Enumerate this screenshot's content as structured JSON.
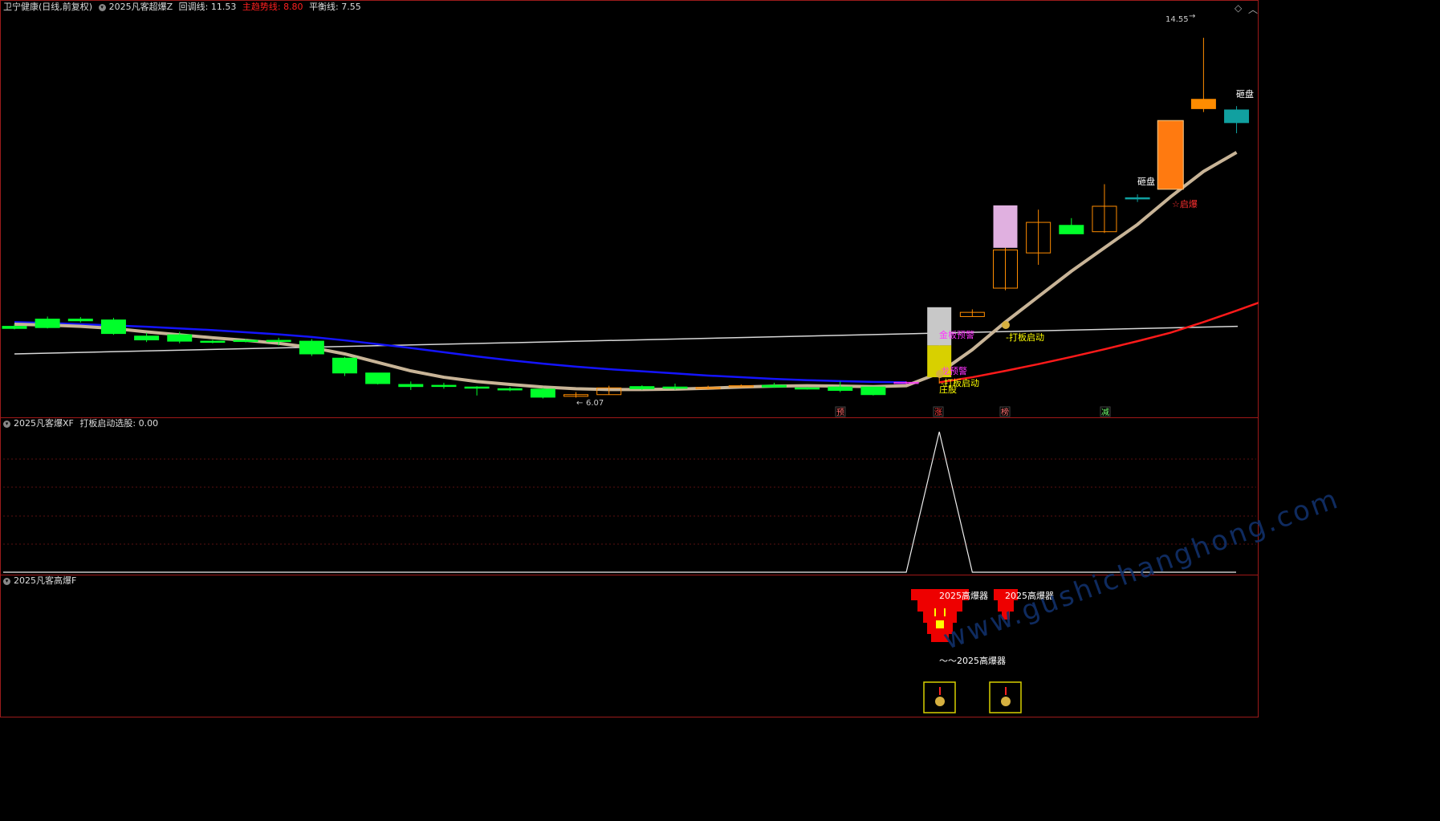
{
  "header": {
    "stock_name": "卫宁健康(日线,前复权)",
    "indicator_name": "2025凡客超爆Z",
    "retrace_label": "回调线:",
    "retrace_value": "11.53",
    "main_label": "主趋势线:",
    "main_value": "8.80",
    "balance_label": "平衡线:",
    "balance_value": "7.55",
    "icons": [
      "diamond-outline-icon",
      "caret-up-icon"
    ]
  },
  "pane2": {
    "title": "2025凡客爆XF",
    "label": "打板启动选股:",
    "value": "0.00"
  },
  "pane3": {
    "title": "2025凡客高爆F"
  },
  "watermark": "www.gushichanghong.com",
  "colors": {
    "up": "#ff8c00",
    "down": "#00ff2a",
    "avg": "#c8b497",
    "blue": "#1414ff",
    "red": "#ff1a1a",
    "white": "#d8d8d8",
    "magenta": "#ff33ff",
    "yellow": "#ffff00"
  },
  "chart_data": {
    "type": "candlestick",
    "price_range": [
      5.7,
      15.1
    ],
    "candles": [
      {
        "o": 7.75,
        "h": 7.8,
        "l": 7.68,
        "c": 7.7
      },
      {
        "o": 7.92,
        "h": 7.98,
        "l": 7.7,
        "c": 7.72
      },
      {
        "o": 7.92,
        "h": 7.97,
        "l": 7.84,
        "c": 7.88
      },
      {
        "o": 7.9,
        "h": 7.95,
        "l": 7.55,
        "c": 7.58
      },
      {
        "o": 7.52,
        "h": 7.6,
        "l": 7.38,
        "c": 7.43
      },
      {
        "o": 7.55,
        "h": 7.62,
        "l": 7.35,
        "c": 7.4
      },
      {
        "o": 7.4,
        "h": 7.43,
        "l": 7.35,
        "c": 7.38
      },
      {
        "o": 7.42,
        "h": 7.45,
        "l": 7.37,
        "c": 7.4
      },
      {
        "o": 7.42,
        "h": 7.48,
        "l": 7.3,
        "c": 7.4
      },
      {
        "o": 7.4,
        "h": 7.45,
        "l": 7.05,
        "c": 7.1
      },
      {
        "o": 7.0,
        "h": 7.03,
        "l": 6.58,
        "c": 6.65
      },
      {
        "o": 6.65,
        "h": 6.65,
        "l": 6.38,
        "c": 6.4
      },
      {
        "o": 6.38,
        "h": 6.45,
        "l": 6.25,
        "c": 6.33
      },
      {
        "o": 6.36,
        "h": 6.42,
        "l": 6.28,
        "c": 6.35
      },
      {
        "o": 6.32,
        "h": 6.34,
        "l": 6.12,
        "c": 6.3
      },
      {
        "o": 6.28,
        "h": 6.32,
        "l": 6.22,
        "c": 6.25
      },
      {
        "o": 6.27,
        "h": 6.3,
        "l": 6.05,
        "c": 6.08
      },
      {
        "o": 6.1,
        "h": 6.2,
        "l": 6.07,
        "c": 6.14
      },
      {
        "o": 6.14,
        "h": 6.35,
        "l": 6.14,
        "c": 6.3
      },
      {
        "o": 6.33,
        "h": 6.36,
        "l": 6.25,
        "c": 6.28
      },
      {
        "o": 6.32,
        "h": 6.4,
        "l": 6.25,
        "c": 6.29
      },
      {
        "o": 6.3,
        "h": 6.35,
        "l": 6.27,
        "c": 6.31
      },
      {
        "o": 6.34,
        "h": 6.38,
        "l": 6.33,
        "c": 6.35
      },
      {
        "o": 6.36,
        "h": 6.42,
        "l": 6.3,
        "c": 6.32
      },
      {
        "o": 6.3,
        "h": 6.32,
        "l": 6.26,
        "c": 6.28
      },
      {
        "o": 6.32,
        "h": 6.45,
        "l": 6.2,
        "c": 6.24
      },
      {
        "o": 6.32,
        "h": 6.32,
        "l": 6.12,
        "c": 6.14
      },
      {
        "o": 6.43,
        "h": 6.45,
        "l": 6.4,
        "c": 6.43
      },
      {
        "o": 7.29,
        "h": 7.9,
        "l": 6.4,
        "c": 7.88
      },
      {
        "o": 7.98,
        "h": 8.15,
        "l": 7.98,
        "c": 8.08
      },
      {
        "o": 8.65,
        "h": 9.97,
        "l": 8.6,
        "c": 9.55
      },
      {
        "o": 9.48,
        "h": 10.5,
        "l": 9.2,
        "c": 10.2
      },
      {
        "o": 10.13,
        "h": 10.3,
        "l": 9.97,
        "c": 9.93
      },
      {
        "o": 9.98,
        "h": 11.1,
        "l": 9.95,
        "c": 10.58
      },
      {
        "o": 10.78,
        "h": 10.86,
        "l": 10.68,
        "c": 10.78
      },
      {
        "o": 10.98,
        "h": 12.6,
        "l": 10.98,
        "c": 12.6
      },
      {
        "o": 12.88,
        "h": 14.55,
        "l": 12.8,
        "c": 13.1
      },
      {
        "o": 12.55,
        "h": 12.94,
        "l": 12.3,
        "c": 12.85
      }
    ],
    "avg_line": [
      7.8,
      7.78,
      7.75,
      7.7,
      7.62,
      7.55,
      7.48,
      7.42,
      7.35,
      7.25,
      7.1,
      6.9,
      6.7,
      6.55,
      6.45,
      6.38,
      6.32,
      6.28,
      6.26,
      6.26,
      6.27,
      6.29,
      6.32,
      6.34,
      6.35,
      6.34,
      6.33,
      6.35,
      6.65,
      7.2,
      7.85,
      8.45,
      9.05,
      9.6,
      10.15,
      10.8,
      11.4,
      11.85
    ],
    "blue_line": [
      7.85,
      7.83,
      7.8,
      7.77,
      7.74,
      7.7,
      7.66,
      7.61,
      7.56,
      7.5,
      7.42,
      7.33,
      7.24,
      7.14,
      7.04,
      6.95,
      6.87,
      6.8,
      6.74,
      6.69,
      6.64,
      6.59,
      6.55,
      6.51,
      6.48,
      6.46,
      6.44,
      6.43
    ],
    "red_line": {
      "start_index": 28,
      "values": [
        6.43,
        6.55,
        6.7,
        6.86,
        7.03,
        7.21,
        7.4,
        7.6,
        7.85,
        8.12,
        8.4
      ]
    },
    "white_line": {
      "start": 7.1,
      "end": 7.75
    },
    "annotations": {
      "high_label": "14.55",
      "low_label": "6.07",
      "sell_label_1": "砸盘",
      "sell_label_2": "砸盘",
      "start_label_1": "打板启动",
      "start_label_2": "打板启动",
      "warn_label_1": "金板预警",
      "warn_label_2": "龙预警",
      "zhuang_label": "庄股",
      "qidong_label": "启爆",
      "bottom_tags": [
        "预",
        "涨",
        "榜",
        "减"
      ]
    },
    "pane2_signal": {
      "index": 28,
      "value": 1
    },
    "pane3_labels": [
      "2025高爆器",
      "2025高爆器",
      "～～2025高爆器"
    ]
  }
}
